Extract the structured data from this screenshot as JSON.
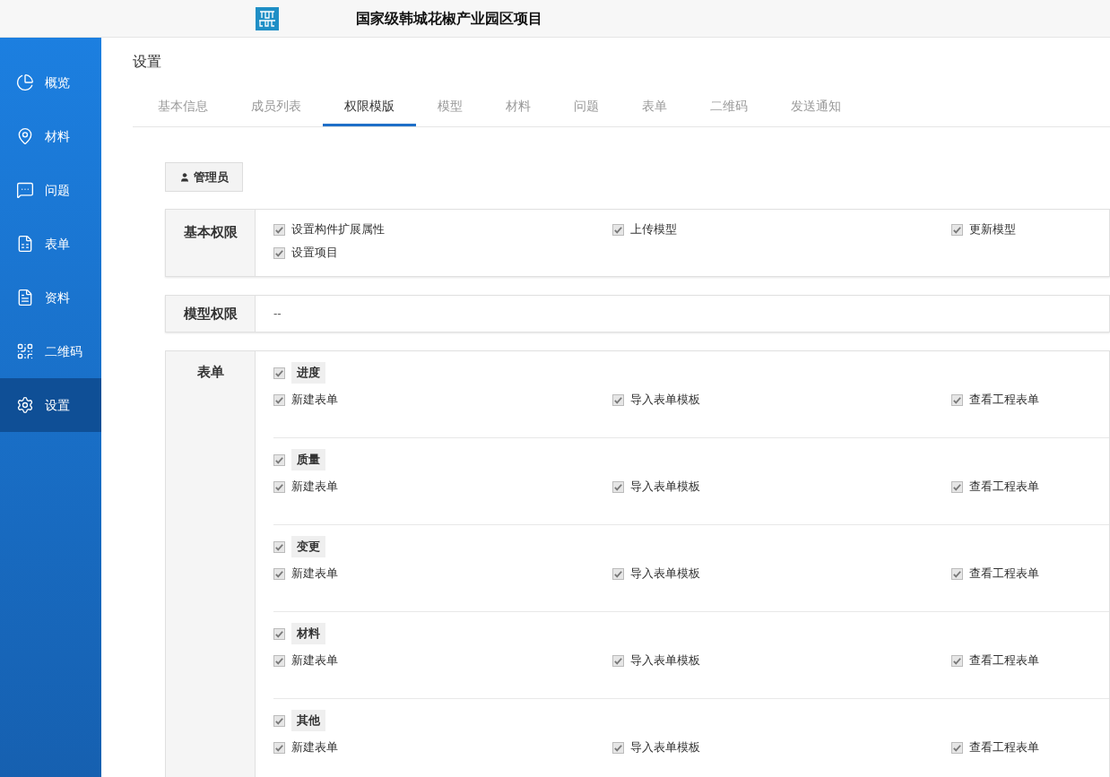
{
  "header": {
    "title": "国家级韩城花椒产业园区项目"
  },
  "sidebar": {
    "items": [
      {
        "label": "概览",
        "selected": false
      },
      {
        "label": "材料",
        "selected": false
      },
      {
        "label": "问题",
        "selected": false
      },
      {
        "label": "表单",
        "selected": false
      },
      {
        "label": "资料",
        "selected": false
      },
      {
        "label": "二维码",
        "selected": false
      },
      {
        "label": "设置",
        "selected": true
      }
    ]
  },
  "page_title": "设置",
  "tabs": [
    {
      "label": "基本信息",
      "selected": false
    },
    {
      "label": "成员列表",
      "selected": false
    },
    {
      "label": "权限模版",
      "selected": true
    },
    {
      "label": "模型",
      "selected": false
    },
    {
      "label": "材料",
      "selected": false
    },
    {
      "label": "问题",
      "selected": false
    },
    {
      "label": "表单",
      "selected": false
    },
    {
      "label": "二维码",
      "selected": false
    },
    {
      "label": "发送通知",
      "selected": false
    }
  ],
  "role_button": "管理员",
  "basic_permissions": {
    "label": "基本权限",
    "items": [
      {
        "label": "设置构件扩展属性",
        "checked": true
      },
      {
        "label": "上传模型",
        "checked": true
      },
      {
        "label": "更新模型",
        "checked": true
      },
      {
        "label": "设置项目",
        "checked": true
      }
    ]
  },
  "model_permissions": {
    "label": "模型权限",
    "value": "--"
  },
  "form_permissions": {
    "label": "表单",
    "groups": [
      {
        "name": "进度",
        "checked": true,
        "items": [
          {
            "label": "新建表单",
            "checked": true
          },
          {
            "label": "导入表单模板",
            "checked": true
          },
          {
            "label": "查看工程表单",
            "checked": true
          }
        ]
      },
      {
        "name": "质量",
        "checked": true,
        "items": [
          {
            "label": "新建表单",
            "checked": true
          },
          {
            "label": "导入表单模板",
            "checked": true
          },
          {
            "label": "查看工程表单",
            "checked": true
          }
        ]
      },
      {
        "name": "变更",
        "checked": true,
        "items": [
          {
            "label": "新建表单",
            "checked": true
          },
          {
            "label": "导入表单模板",
            "checked": true
          },
          {
            "label": "查看工程表单",
            "checked": true
          }
        ]
      },
      {
        "name": "材料",
        "checked": true,
        "items": [
          {
            "label": "新建表单",
            "checked": true
          },
          {
            "label": "导入表单模板",
            "checked": true
          },
          {
            "label": "查看工程表单",
            "checked": true
          }
        ]
      },
      {
        "name": "其他",
        "checked": true,
        "items": [
          {
            "label": "新建表单",
            "checked": true
          },
          {
            "label": "导入表单模板",
            "checked": true
          },
          {
            "label": "查看工程表单",
            "checked": true
          }
        ]
      }
    ]
  }
}
